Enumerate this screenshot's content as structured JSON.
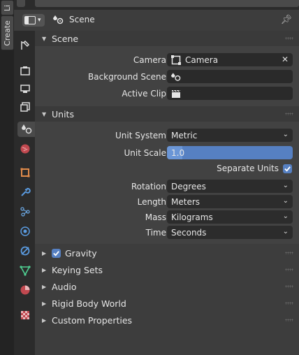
{
  "left_tabs": [
    "Li",
    "Create"
  ],
  "header": {
    "breadcrumb": "Scene"
  },
  "scene_panel": {
    "title": "Scene",
    "camera_label": "Camera",
    "camera_value": "Camera",
    "background_label": "Background Scene",
    "clip_label": "Active Clip"
  },
  "units_panel": {
    "title": "Units",
    "unit_system_label": "Unit System",
    "unit_system_value": "Metric",
    "unit_scale_label": "Unit Scale",
    "unit_scale_value": "1.0",
    "separate_units_label": "Separate Units",
    "rotation_label": "Rotation",
    "rotation_value": "Degrees",
    "length_label": "Length",
    "length_value": "Meters",
    "mass_label": "Mass",
    "mass_value": "Kilograms",
    "time_label": "Time",
    "time_value": "Seconds"
  },
  "collapsed_panels": {
    "gravity": "Gravity",
    "keying_sets": "Keying Sets",
    "audio": "Audio",
    "rigid_body": "Rigid Body World",
    "custom_props": "Custom Properties"
  },
  "colors": {
    "accent": "#5680c2",
    "background": "#3d3d3d"
  }
}
